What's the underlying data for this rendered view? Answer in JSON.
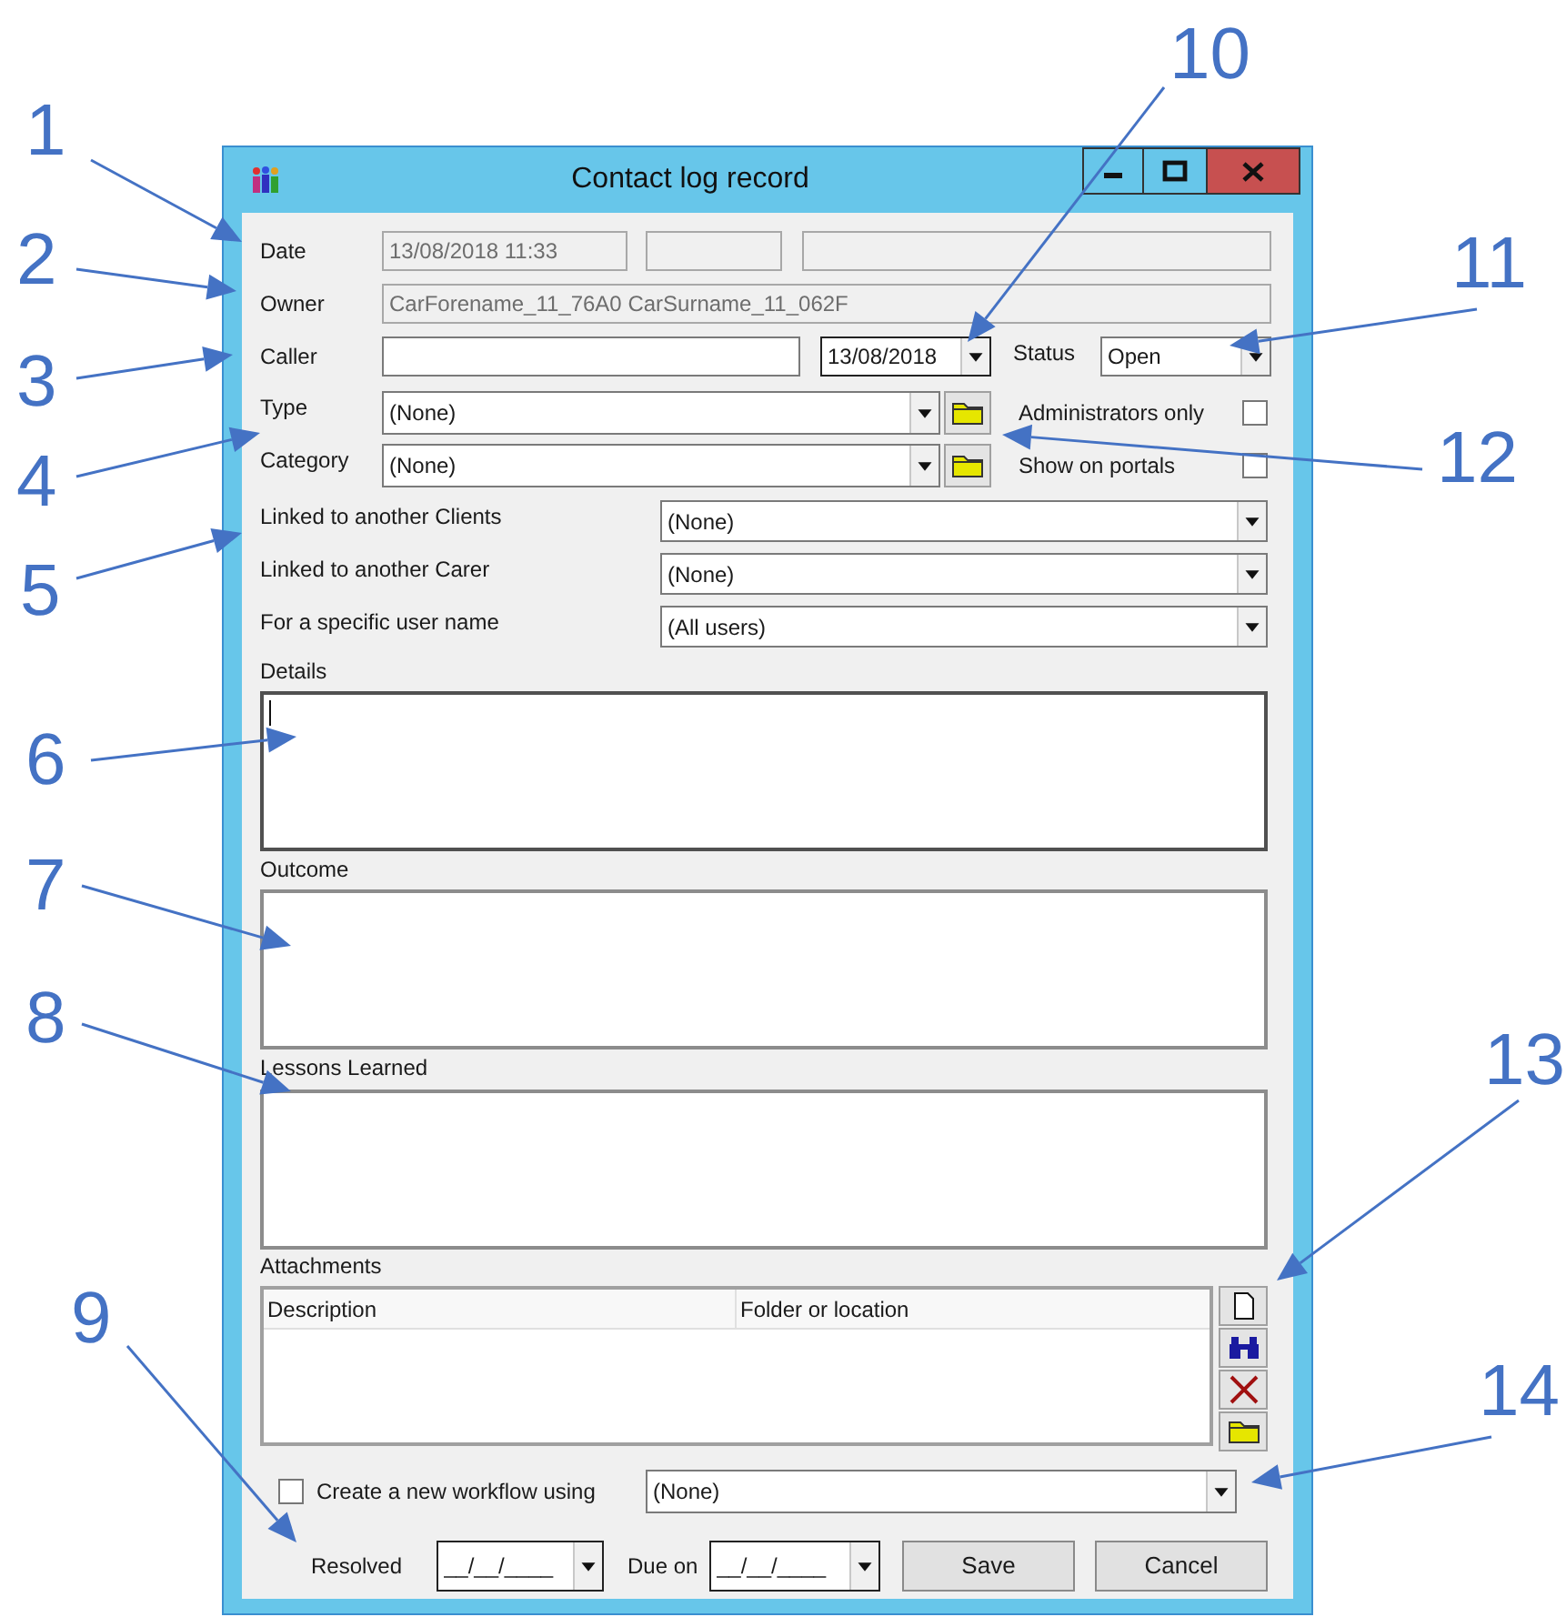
{
  "window": {
    "title": "Contact log record"
  },
  "date": {
    "label": "Date",
    "value": "13/08/2018 11:33"
  },
  "owner": {
    "label": "Owner",
    "value": "CarForename_11_76A0 CarSurname_11_062F"
  },
  "caller": {
    "label": "Caller",
    "date": "13/08/2018"
  },
  "status": {
    "label": "Status",
    "value": "Open"
  },
  "type": {
    "label": "Type",
    "value": "(None)"
  },
  "category": {
    "label": "Category",
    "value": "(None)"
  },
  "options": [
    {
      "label": "Administrators only",
      "checked": false
    },
    {
      "label": "Show on portals",
      "checked": false
    }
  ],
  "selectors": [
    {
      "label": "Linked to another Clients",
      "value": "(None)"
    },
    {
      "label": "Linked to another Carer",
      "value": "(None)"
    },
    {
      "label": "For a specific user name",
      "value": "(All users)"
    }
  ],
  "text_areas": [
    {
      "label": "Details",
      "focused": true
    },
    {
      "label": "Outcome",
      "focused": false
    },
    {
      "label": "Lessons Learned",
      "focused": false
    }
  ],
  "attachments": {
    "label": "Attachments",
    "columns": [
      "Description",
      "Folder or location"
    ]
  },
  "workflow": {
    "label": "Create a new workflow using",
    "checked": false,
    "value": "(None)"
  },
  "resolved": {
    "label": "Resolved",
    "value": "__/__/____"
  },
  "due_on": {
    "label": "Due on",
    "value": "__/__/____"
  },
  "buttons": [
    "Save",
    "Cancel"
  ],
  "callouts": [
    {
      "label": "1"
    },
    {
      "label": "2"
    },
    {
      "label": "3"
    },
    {
      "label": "4"
    },
    {
      "label": "5"
    },
    {
      "label": "6"
    },
    {
      "label": "7"
    },
    {
      "label": "8"
    },
    {
      "label": "9"
    },
    {
      "label": "10"
    },
    {
      "label": "11"
    },
    {
      "label": "12"
    },
    {
      "label": "13"
    },
    {
      "label": "14"
    }
  ]
}
